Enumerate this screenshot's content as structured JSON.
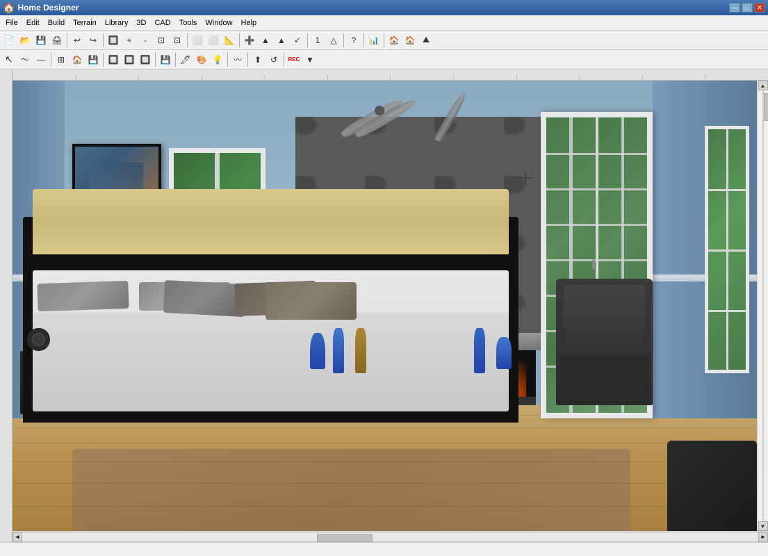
{
  "window": {
    "title": "Home Designer",
    "icon": "🏠"
  },
  "title_controls": {
    "minimize": "—",
    "maximize": "□",
    "close": "✕"
  },
  "menu": {
    "items": [
      "File",
      "Edit",
      "Build",
      "Terrain",
      "Library",
      "3D",
      "CAD",
      "Tools",
      "Window",
      "Help"
    ]
  },
  "toolbar1": {
    "buttons": [
      "📄",
      "📂",
      "💾",
      "🖨",
      "↩",
      "↪",
      "🔍",
      "🔍+",
      "🔍-",
      "⊡",
      "⊡",
      "⬜",
      "⬜",
      "📐",
      "➕",
      "🔼",
      "🔼",
      "✓",
      "❶",
      "🔺",
      "⟐",
      "?",
      "📊",
      "🏠",
      "🏠",
      "⛰"
    ]
  },
  "toolbar2": {
    "buttons": [
      "↖",
      "〜",
      "—",
      "⊞",
      "🏠",
      "💾",
      "🔲",
      "🔲",
      "🔲",
      "💾",
      "🖊",
      "🎨",
      "📡",
      "〰",
      "⬆",
      "⟲",
      "⏺"
    ]
  },
  "statusbar": {
    "text": ""
  },
  "scene": {
    "type": "3D bedroom interior",
    "description": "Master bedroom with fireplace, bed, French doors"
  }
}
